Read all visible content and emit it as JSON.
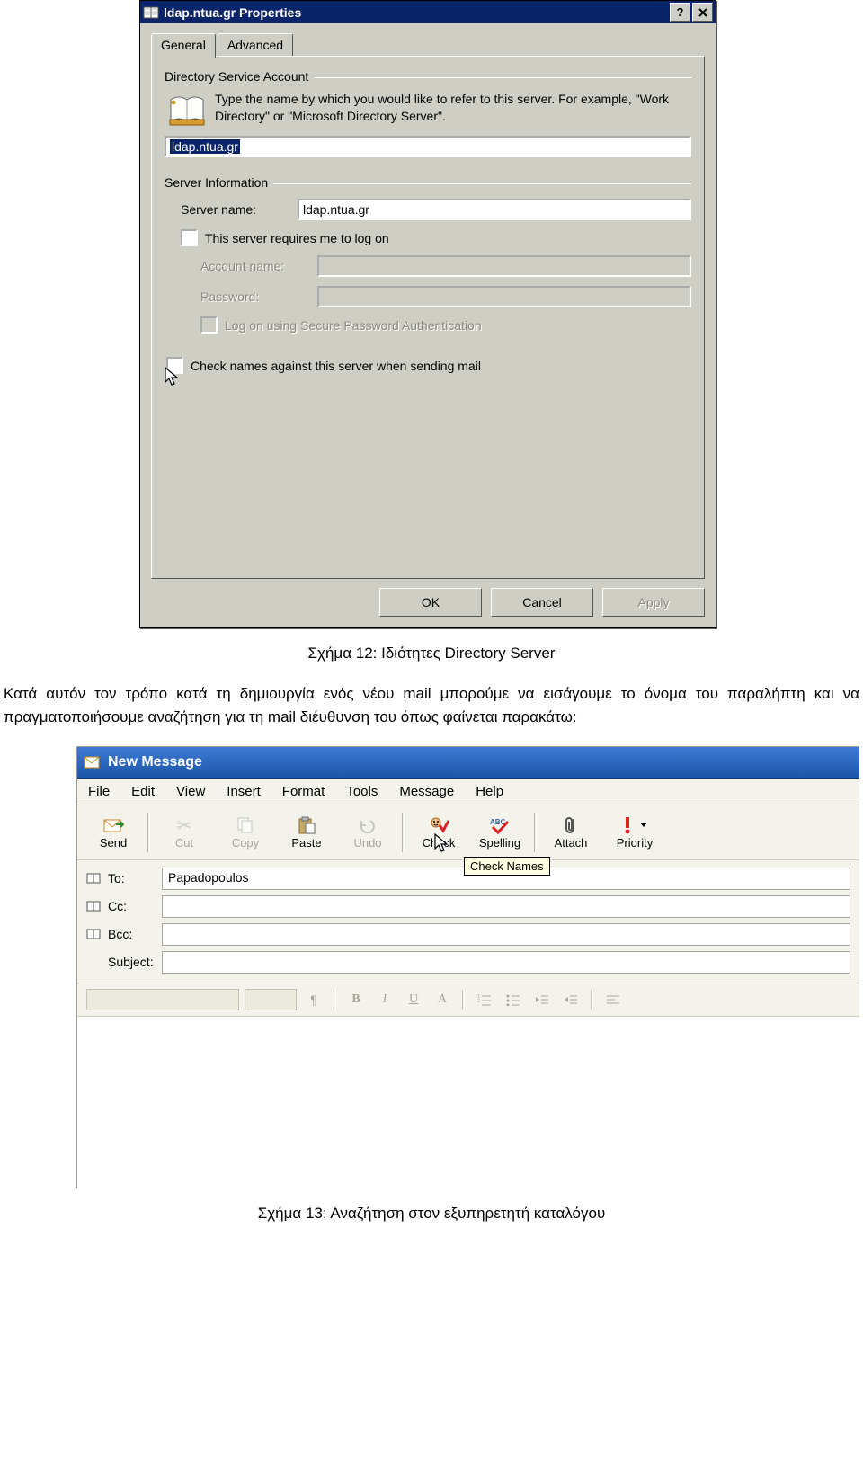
{
  "dlg1": {
    "title": "ldap.ntua.gr Properties",
    "tabs": {
      "general": "General",
      "advanced": "Advanced"
    },
    "group_account": "Directory Service Account",
    "account_desc": "Type the name by which you would like to refer to this server. For example, \"Work Directory\" or \"Microsoft Directory Server\".",
    "account_value": "ldap.ntua.gr",
    "group_server": "Server Information",
    "server_name_label": "Server name:",
    "server_name_value": "ldap.ntua.gr",
    "requires_logon": "This server requires me to log on",
    "account_name_label": "Account name:",
    "password_label": "Password:",
    "spa_label": "Log on using Secure Password Authentication",
    "check_names_label": "Check names against this server when sending mail",
    "buttons": {
      "ok": "OK",
      "cancel": "Cancel",
      "apply": "Apply"
    }
  },
  "caption1": "Σχήμα 12: Ιδιότητες Directory Server",
  "para1": "Κατά αυτόν τον τρόπο κατά τη δημιουργία ενός νέου mail μπορούμε να εισάγουμε το όνομα του παραλήπτη και να πραγματοποιήσουμε αναζήτηση για τη mail διέυθυνση του όπως φαίνεται παρακάτω:",
  "dlg2": {
    "title": "New Message",
    "menu": {
      "file": "File",
      "edit": "Edit",
      "view": "View",
      "insert": "Insert",
      "format": "Format",
      "tools": "Tools",
      "message": "Message",
      "help": "Help"
    },
    "tools": {
      "send": "Send",
      "cut": "Cut",
      "copy": "Copy",
      "paste": "Paste",
      "undo": "Undo",
      "check": "Check",
      "spelling": "Spelling",
      "attach": "Attach",
      "priority": "Priority"
    },
    "tooltip": "Check Names",
    "labels": {
      "to": "To:",
      "cc": "Cc:",
      "bcc": "Bcc:",
      "subject": "Subject:"
    },
    "to_value": "Papadopoulos"
  },
  "caption2": "Σχήμα 13: Αναζήτηση στον εξυπηρετητή καταλόγου"
}
